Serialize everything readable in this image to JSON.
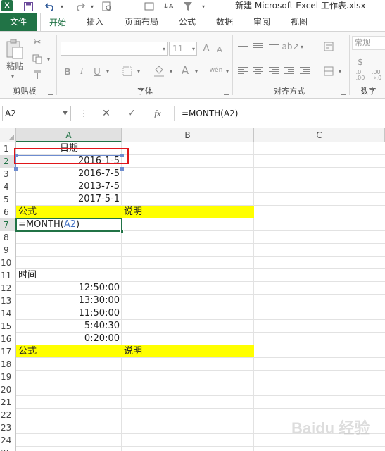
{
  "app": {
    "title": "新建 Microsoft Excel 工作表.xlsx -",
    "logo_letter": "X"
  },
  "quick_access": {
    "icons": [
      "save-icon",
      "undo-icon",
      "redo-icon",
      "print-preview-icon",
      "sort-icon",
      "filter-icon",
      "customize-icon"
    ]
  },
  "tabs": [
    {
      "label": "文件"
    },
    {
      "label": "开始"
    },
    {
      "label": "插入"
    },
    {
      "label": "页面布局"
    },
    {
      "label": "公式"
    },
    {
      "label": "数据"
    },
    {
      "label": "审阅"
    },
    {
      "label": "视图"
    }
  ],
  "ribbon": {
    "clipboard": {
      "label": "剪贴板",
      "paste_label": "粘贴"
    },
    "font": {
      "label": "字体",
      "size": "11",
      "bold": "B",
      "italic": "I",
      "underline": "U",
      "font_color_glyph": "A",
      "grow": "A",
      "shrink": "A",
      "wen": "wén"
    },
    "alignment": {
      "label": "对齐方式"
    },
    "number": {
      "label": "数字",
      "format": "常规",
      "inc_decimal": ".0\n.00",
      "dec_decimal": ".00\n→.0"
    }
  },
  "formula_bar": {
    "name_box": "A2",
    "cancel_glyph": "✕",
    "enter_glyph": "✓",
    "fx_glyph": "fx",
    "formula": "=MONTH(A2)"
  },
  "grid": {
    "columns": [
      "A",
      "B",
      "C"
    ],
    "rows": [
      "1",
      "2",
      "3",
      "4",
      "5",
      "6",
      "7",
      "8",
      "9",
      "10",
      "11",
      "12",
      "13",
      "14",
      "15",
      "16",
      "17",
      "18",
      "19",
      "20",
      "21",
      "22",
      "23",
      "24",
      "25"
    ],
    "cells": {
      "A1": "日期",
      "A2": "2016-1-5",
      "A3": "2016-7-5",
      "A4": "2013-7-5",
      "A5": "2017-5-1",
      "A6": "公式",
      "B6": "说明",
      "A7_prefix": "=MONTH(",
      "A7_ref": "A2",
      "A7_suffix": ")",
      "A11": "时间",
      "A12": "12:50:00",
      "A13": "13:30:00",
      "A14": "11:50:00",
      "A15": "5:40:30",
      "A16": "0:20:00",
      "A17": "公式",
      "B17": "说明"
    },
    "highlight_color": "#ffff00",
    "active_color": "#217346",
    "reference_color": "#4472c4",
    "annotation_color": "#e0161a"
  },
  "watermark": "Baidu 经验"
}
